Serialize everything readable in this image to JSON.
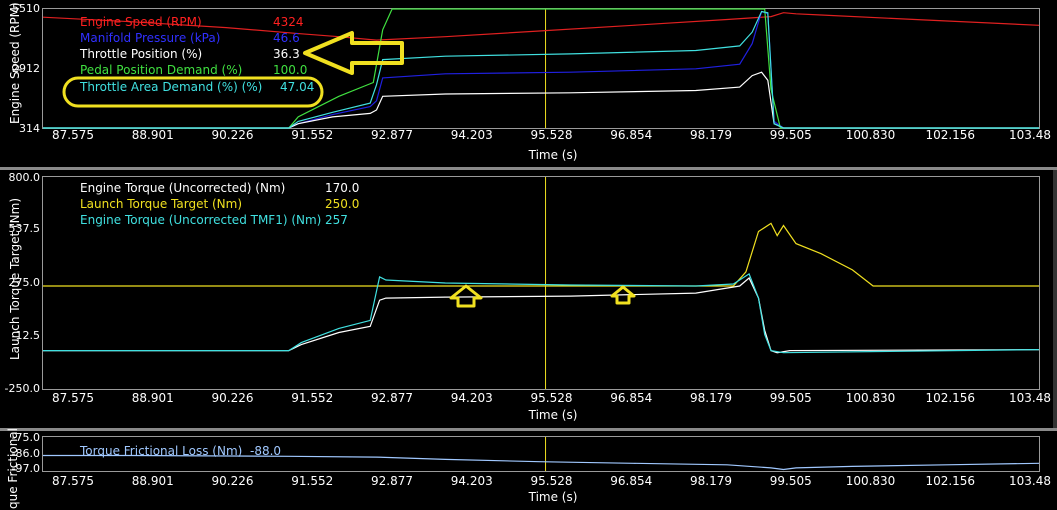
{
  "chart_data": [
    {
      "type": "line",
      "ylabel": "Engine Speed (RPM)",
      "yticks": [
        "5510",
        "2912",
        "314"
      ],
      "ylim": [
        314,
        5510
      ],
      "xlabel": "Time (s)",
      "xlim": [
        87.575,
        103.48
      ],
      "xticks": [
        "87.575",
        "88.901",
        "90.226",
        "91.552",
        "92.877",
        "94.203",
        "95.528",
        "96.854",
        "98.179",
        "99.505",
        "100.830",
        "102.156",
        "103.48"
      ],
      "cursor_x": 95.6,
      "legend": [
        {
          "name": "Engine Speed (RPM)",
          "value": "4324",
          "color": "#ff2020"
        },
        {
          "name": "Manifold Pressure (kPa)",
          "value": "46.6",
          "color": "#2020ff"
        },
        {
          "name": "Throttle Position (%)",
          "value": "36.3",
          "color": "#ffffff"
        },
        {
          "name": "Pedal Position Demand (%)",
          "value": "100.0",
          "color": "#40e040"
        },
        {
          "name": "Throttle Area Demand  (%) (%)",
          "value": "47.04",
          "color": "#40e0e0"
        }
      ],
      "series": [
        {
          "name": "Engine Speed (RPM)",
          "color": "#e02020",
          "x": [
            87.575,
            89.0,
            90.5,
            91.6,
            92.3,
            92.9,
            94.0,
            95.5,
            97.0,
            98.5,
            99.2,
            99.4,
            99.6,
            100.0,
            101.5,
            103.48
          ],
          "y": [
            5150,
            4950,
            4700,
            4450,
            4300,
            4150,
            4300,
            4550,
            4800,
            5050,
            5180,
            5350,
            5300,
            5250,
            5050,
            4800
          ]
        },
        {
          "name": "Manifold Pressure (kPa)",
          "color": "#2020e0",
          "x": [
            87.575,
            91.5,
            91.65,
            92.2,
            92.8,
            92.9,
            93.0,
            94.0,
            96.0,
            98.0,
            98.7,
            98.9,
            99.05,
            99.15,
            99.25,
            99.4,
            103.48
          ],
          "y": [
            314,
            314,
            500,
            900,
            1250,
            1500,
            2500,
            2680,
            2750,
            2900,
            3100,
            4000,
            5400,
            5300,
            600,
            314,
            314
          ]
        },
        {
          "name": "Throttle Position (%)",
          "color": "#ffffff",
          "x": [
            87.575,
            91.5,
            91.65,
            92.2,
            92.8,
            92.9,
            93.0,
            94.0,
            96.0,
            98.0,
            98.7,
            98.9,
            99.05,
            99.15,
            99.25,
            99.4,
            103.48
          ],
          "y": [
            314,
            314,
            500,
            800,
            950,
            1100,
            1700,
            1800,
            1850,
            1950,
            2100,
            2600,
            2750,
            2400,
            500,
            314,
            314
          ]
        },
        {
          "name": "Pedal Position Demand (%)",
          "color": "#40e040",
          "x": [
            87.575,
            91.5,
            91.65,
            92.3,
            92.85,
            93.0,
            93.15,
            99.0,
            99.1,
            99.2,
            99.35,
            103.48
          ],
          "y": [
            314,
            314,
            800,
            1700,
            2300,
            4600,
            5510,
            5510,
            5510,
            2000,
            314,
            314
          ]
        },
        {
          "name": "Throttle Area Demand  (%) (%)",
          "color": "#40e0e0",
          "x": [
            87.575,
            91.5,
            91.65,
            92.2,
            92.8,
            92.9,
            93.0,
            94.0,
            96.0,
            98.0,
            98.7,
            98.9,
            99.05,
            99.15,
            99.25,
            99.4,
            103.48
          ],
          "y": [
            314,
            314,
            600,
            1000,
            1400,
            2200,
            3300,
            3450,
            3550,
            3700,
            3900,
            4500,
            5400,
            5350,
            500,
            314,
            314
          ]
        }
      ],
      "annotations": [
        {
          "type": "arrow",
          "direction": "left",
          "color": "#f0e020",
          "target_series": "Throttle Position (%)"
        },
        {
          "type": "ellipse",
          "color": "#f0e020",
          "target_series": "Throttle Area Demand  (%) (%)"
        }
      ]
    },
    {
      "type": "line",
      "ylabel": "Launch Torque Target (Nm)",
      "yticks": [
        "800.0",
        "537.5",
        "275.0",
        "12.5",
        "-250.0"
      ],
      "ylim": [
        -250,
        800
      ],
      "xlabel": "Time (s)",
      "xlim": [
        87.575,
        103.48
      ],
      "xticks": [
        "87.575",
        "88.901",
        "90.226",
        "91.552",
        "92.877",
        "94.203",
        "95.528",
        "96.854",
        "98.179",
        "99.505",
        "100.830",
        "102.156",
        "103.48"
      ],
      "cursor_x": 95.6,
      "legend": [
        {
          "name": "Engine Torque (Uncorrected) (Nm)",
          "value": "170.0",
          "color": "#ffffff"
        },
        {
          "name": "Launch Torque Target (Nm)",
          "value": "250.0",
          "color": "#f0e020"
        },
        {
          "name": "Engine Torque (Uncorrected TMF1) (Nm)",
          "value": "257",
          "color": "#40e0e0"
        }
      ],
      "series": [
        {
          "name": "Engine Torque (Uncorrected) (Nm)",
          "color": "#ffffff",
          "x": [
            87.575,
            91.5,
            91.7,
            92.3,
            92.8,
            92.95,
            93.05,
            94.0,
            96.0,
            98.0,
            98.7,
            98.85,
            99.0,
            99.1,
            99.2,
            99.3,
            99.5,
            103.48
          ],
          "y": [
            -60,
            -60,
            -30,
            30,
            60,
            190,
            200,
            205,
            210,
            225,
            260,
            300,
            200,
            40,
            -60,
            -70,
            -60,
            -55
          ]
        },
        {
          "name": "Launch Torque Target (Nm)",
          "color": "#f0e020",
          "x": [
            87.575,
            98.6,
            98.8,
            99.0,
            99.2,
            99.3,
            99.4,
            99.6,
            100.0,
            100.5,
            100.83,
            103.48
          ],
          "y": [
            260,
            260,
            330,
            530,
            570,
            510,
            560,
            470,
            420,
            340,
            260,
            260
          ]
        },
        {
          "name": "Engine Torque (Uncorrected TMF1) (Nm)",
          "color": "#40e0e0",
          "x": [
            87.575,
            91.5,
            91.7,
            92.3,
            92.8,
            92.95,
            93.05,
            94.0,
            96.0,
            98.0,
            98.6,
            98.85,
            99.0,
            99.1,
            99.2,
            99.4,
            103.48
          ],
          "y": [
            -60,
            -60,
            -20,
            50,
            90,
            305,
            290,
            275,
            265,
            260,
            270,
            320,
            200,
            20,
            -60,
            -70,
            -55
          ]
        }
      ],
      "annotations": [
        {
          "type": "arrow",
          "direction": "up",
          "color": "#f0e020",
          "x": 94.2
        },
        {
          "type": "arrow",
          "direction": "up",
          "color": "#f0e020",
          "x": 96.75
        }
      ]
    },
    {
      "type": "line",
      "ylabel": "que Frictional",
      "yticks": [
        "-75.0",
        "-86.0",
        "-97.0"
      ],
      "ylim": [
        -97,
        -75
      ],
      "xlabel": "Time (s)",
      "xlim": [
        87.575,
        103.48
      ],
      "xticks": [
        "87.575",
        "88.901",
        "90.226",
        "91.552",
        "92.877",
        "94.203",
        "95.528",
        "96.854",
        "98.179",
        "99.505",
        "100.830",
        "102.156",
        "103.48"
      ],
      "cursor_x": 95.6,
      "legend": [
        {
          "name": "Torque Frictional Loss (Nm)",
          "value": "-88.0",
          "color": "#a0c8ff"
        }
      ],
      "series": [
        {
          "name": "Torque Frictional Loss (Nm)",
          "color": "#a0c8ff",
          "x": [
            87.575,
            89.0,
            91.5,
            92.9,
            94.0,
            95.5,
            97.0,
            98.5,
            99.2,
            99.4,
            99.6,
            100.5,
            102.0,
            103.48
          ],
          "y": [
            -87,
            -87,
            -87.5,
            -88,
            -89.5,
            -91,
            -92,
            -93,
            -95,
            -96,
            -95,
            -94,
            -93,
            -92
          ]
        }
      ]
    }
  ]
}
